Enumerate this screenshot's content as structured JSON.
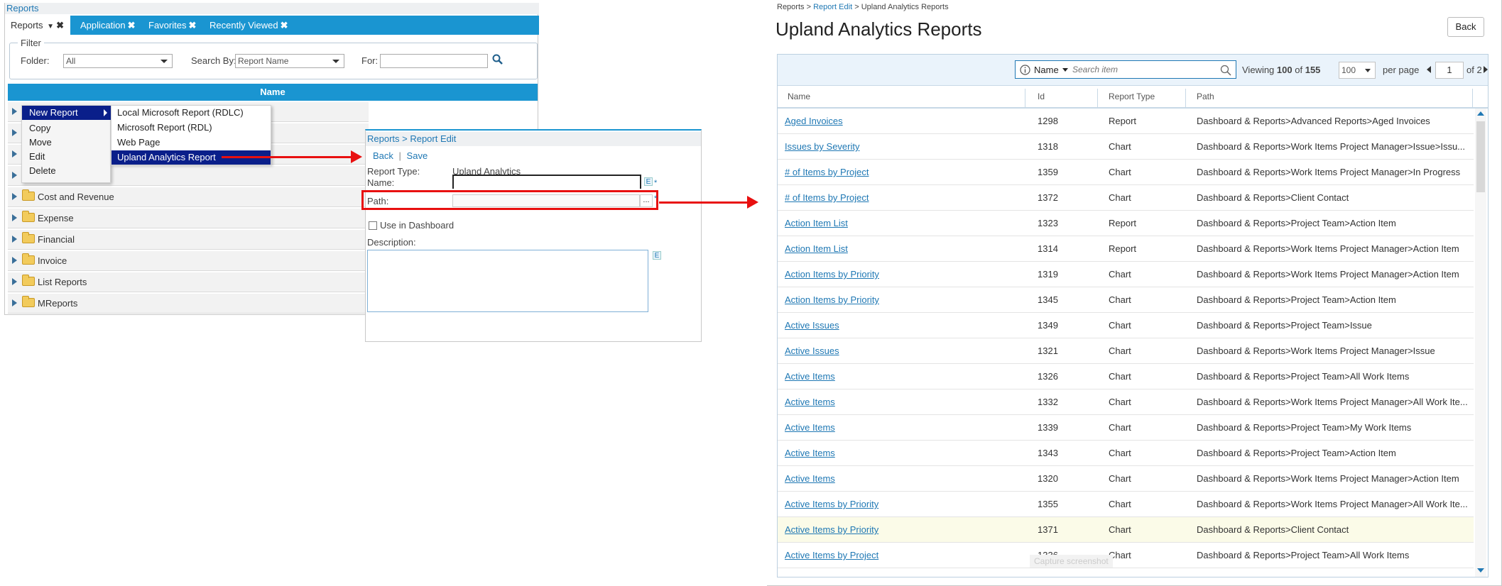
{
  "reports_panel": {
    "title": "Reports",
    "tabs": [
      {
        "label": "Reports"
      },
      {
        "label": "Application"
      },
      {
        "label": "Favorites"
      },
      {
        "label": "Recently Viewed"
      }
    ],
    "filter": {
      "legend": "Filter",
      "folder_label": "Folder:",
      "folder_value": "All",
      "search_by_label": "Search By:",
      "search_by_value": "Report Name",
      "for_label": "For:"
    },
    "column_header": "Name",
    "folders": [
      "Cost and Revenue",
      "Expense",
      "Financial",
      "Invoice",
      "List Reports",
      "MReports"
    ],
    "context_menu": [
      "New Report",
      "Copy",
      "Move",
      "Edit",
      "Delete"
    ],
    "submenu": [
      "Local Microsoft Report (RDLC)",
      "Microsoft Report (RDL)",
      "Web Page",
      "Upland Analytics Report"
    ]
  },
  "edit_panel": {
    "breadcrumb": "Reports > Report Edit",
    "back": "Back",
    "separator": "|",
    "save": "Save",
    "report_type_label": "Report Type:",
    "report_type_value": "Upland Analytics",
    "name_label": "Name:",
    "path_label": "Path:",
    "browse": "...",
    "use_dashboard_label": "Use in Dashboard",
    "description_label": "Description:",
    "e_icon": "E",
    "required": "*"
  },
  "analytics_panel": {
    "breadcrumb": {
      "a": "Reports",
      "sep": ">",
      "b": "Report Edit",
      "c": "Upland Analytics Reports"
    },
    "title": "Upland Analytics Reports",
    "back": "Back",
    "search": {
      "field": "Name",
      "placeholder": "Search item"
    },
    "viewing": {
      "prefix": "Viewing",
      "count": "100",
      "of": "of",
      "total": "155"
    },
    "per_page_value": "100",
    "per_page_label": "per page",
    "page_value": "1",
    "page_of": "of 2",
    "columns": [
      "Name",
      "Id",
      "Report Type",
      "Path"
    ],
    "rows": [
      {
        "name": "Aged Invoices",
        "id": "1298",
        "type": "Report",
        "path": "Dashboard & Reports>Advanced Reports>Aged Invoices"
      },
      {
        "name": "Issues by Severity",
        "id": "1318",
        "type": "Chart",
        "path": "Dashboard & Reports>Work Items Project Manager>Issue>Issu..."
      },
      {
        "name": "# of Items by Project",
        "id": "1359",
        "type": "Chart",
        "path": "Dashboard & Reports>Work Items Project Manager>In Progress"
      },
      {
        "name": "# of Items by Project",
        "id": "1372",
        "type": "Chart",
        "path": "Dashboard & Reports>Client Contact"
      },
      {
        "name": "Action Item List",
        "id": "1323",
        "type": "Report",
        "path": "Dashboard & Reports>Project Team>Action Item"
      },
      {
        "name": "Action Item List",
        "id": "1314",
        "type": "Report",
        "path": "Dashboard & Reports>Work Items Project Manager>Action Item"
      },
      {
        "name": "Action Items by Priority",
        "id": "1319",
        "type": "Chart",
        "path": "Dashboard & Reports>Work Items Project Manager>Action Item"
      },
      {
        "name": "Action Items by Priority",
        "id": "1345",
        "type": "Chart",
        "path": "Dashboard & Reports>Project Team>Action Item"
      },
      {
        "name": "Active Issues",
        "id": "1349",
        "type": "Chart",
        "path": "Dashboard & Reports>Project Team>Issue"
      },
      {
        "name": "Active Issues",
        "id": "1321",
        "type": "Chart",
        "path": "Dashboard & Reports>Work Items Project Manager>Issue"
      },
      {
        "name": "Active Items",
        "id": "1326",
        "type": "Chart",
        "path": "Dashboard & Reports>Project Team>All Work Items"
      },
      {
        "name": "Active Items",
        "id": "1332",
        "type": "Chart",
        "path": "Dashboard & Reports>Work Items Project Manager>All Work Ite..."
      },
      {
        "name": "Active Items",
        "id": "1339",
        "type": "Chart",
        "path": "Dashboard & Reports>Project Team>My Work Items"
      },
      {
        "name": "Active Items",
        "id": "1343",
        "type": "Chart",
        "path": "Dashboard & Reports>Project Team>Action Item"
      },
      {
        "name": "Active Items",
        "id": "1320",
        "type": "Chart",
        "path": "Dashboard & Reports>Work Items Project Manager>Action Item"
      },
      {
        "name": "Active Items by Priority",
        "id": "1355",
        "type": "Chart",
        "path": "Dashboard & Reports>Work Items Project Manager>All Work Ite..."
      },
      {
        "name": "Active Items by Priority",
        "id": "1371",
        "type": "Chart",
        "path": "Dashboard & Reports>Client Contact"
      },
      {
        "name": "Active Items by Project",
        "id": "1336",
        "type": "Chart",
        "path": "Dashboard & Reports>Project Team>All Work Items"
      }
    ],
    "watermark": "Capture screenshot"
  },
  "colors": {
    "accent": "#1a95d1",
    "link": "#1f78b4",
    "menu_highlight": "#0a1f8a",
    "arrow": "#e81010",
    "row_highlight": "#fbfbe8"
  },
  "icons": [
    "search-icon",
    "folder-icon",
    "expand-arrow-icon",
    "close-icon",
    "info-icon",
    "dropdown-caret-icon",
    "prev-page-icon",
    "next-page-icon",
    "scroll-up-icon",
    "scroll-down-icon"
  ]
}
